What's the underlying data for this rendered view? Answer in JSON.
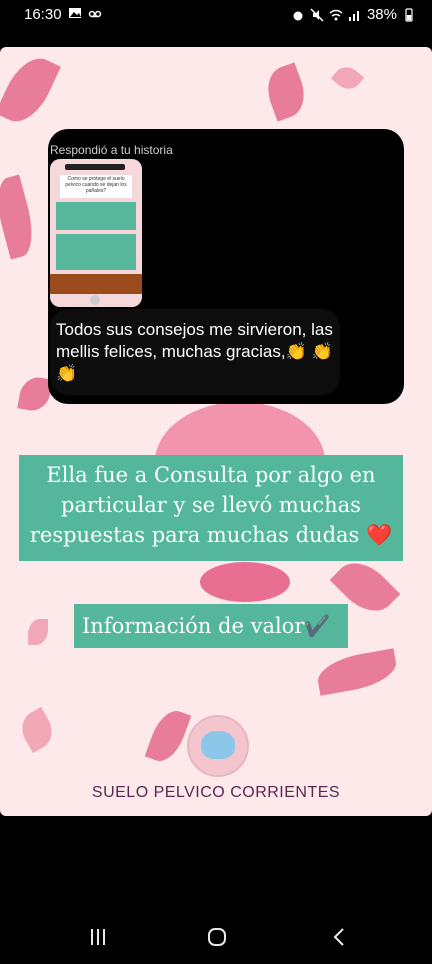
{
  "status_bar": {
    "time": "16:30",
    "battery": "38%"
  },
  "story": {
    "replied_label": "Respondió a tu historia",
    "thumbnail_question": "Como se protege el suelo pelvico cuando se dejan los pañales?",
    "reply_text": "Todos sus consejos me sirvieron, las mellis felices, muchas gracias,👏 👏👏",
    "banner_text": "Ella fue a Consulta por algo en particular y se llevó muchas respuestas para muchas dudas ❤️",
    "info_text": "Información de valor✔️",
    "brand_name": "SUELO PELVICO CORRIENTES"
  },
  "colors": {
    "accent": "#54b79c",
    "background": "#fde8ea",
    "leaf": "#e87d9a"
  }
}
